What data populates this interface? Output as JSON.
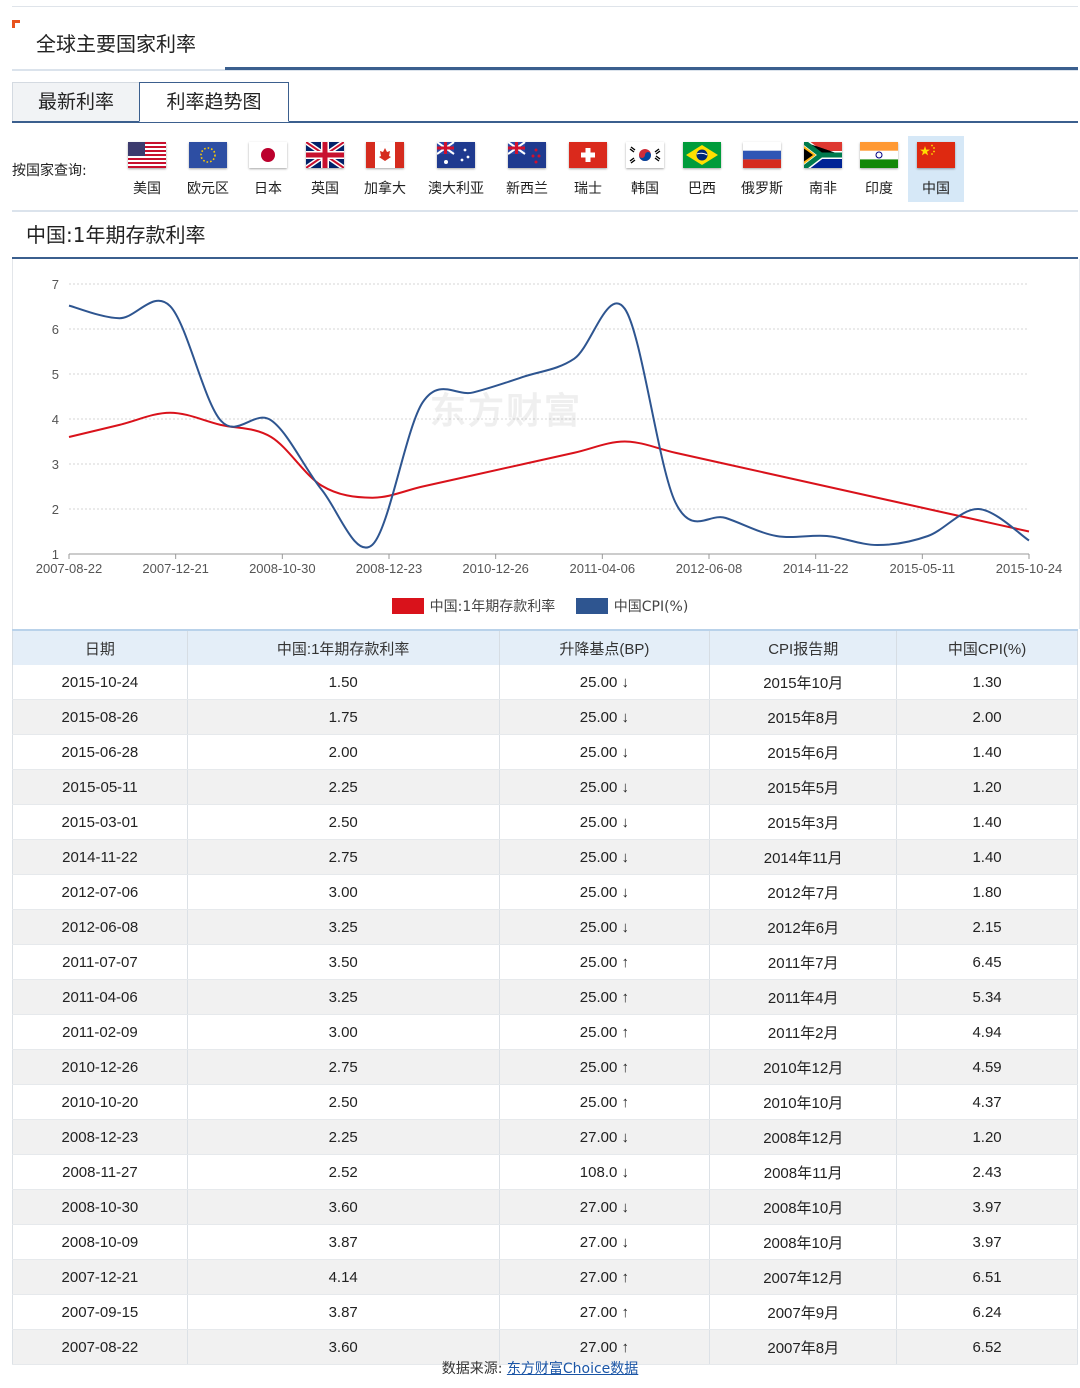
{
  "page": {
    "title": "全球主要国家利率"
  },
  "tabs": [
    {
      "label": "最新利率",
      "active": false
    },
    {
      "label": "利率趋势图",
      "active": true
    }
  ],
  "country_label": "按国家查询:",
  "countries": [
    {
      "name": "美国",
      "flag": "us-flag-icon"
    },
    {
      "name": "欧元区",
      "flag": "eu-flag-icon"
    },
    {
      "name": "日本",
      "flag": "jp-flag-icon"
    },
    {
      "name": "英国",
      "flag": "uk-flag-icon"
    },
    {
      "name": "加拿大",
      "flag": "ca-flag-icon"
    },
    {
      "name": "澳大利亚",
      "flag": "au-flag-icon"
    },
    {
      "name": "新西兰",
      "flag": "nz-flag-icon"
    },
    {
      "name": "瑞士",
      "flag": "ch-flag-icon"
    },
    {
      "name": "韩国",
      "flag": "kr-flag-icon"
    },
    {
      "name": "巴西",
      "flag": "br-flag-icon"
    },
    {
      "name": "俄罗斯",
      "flag": "ru-flag-icon"
    },
    {
      "name": "南非",
      "flag": "za-flag-icon"
    },
    {
      "name": "印度",
      "flag": "in-flag-icon"
    },
    {
      "name": "中国",
      "flag": "cn-flag-icon",
      "selected": true
    }
  ],
  "section_title": "中国:1年期存款利率",
  "watermark": "东方财富",
  "chart_data": {
    "type": "line",
    "ylim": [
      1,
      7
    ],
    "yticks": [
      "1",
      "2",
      "3",
      "4",
      "5",
      "6",
      "7"
    ],
    "xtick_labels": [
      "2007-08-22",
      "2007-12-21",
      "2008-10-30",
      "2008-12-23",
      "2010-12-26",
      "2011-04-06",
      "2012-06-08",
      "2014-11-22",
      "2015-05-11",
      "2015-10-24"
    ],
    "grid": true,
    "legend_position": "bottom",
    "series": [
      {
        "name": "中国:1年期存款利率",
        "color": "#d9121b",
        "values": [
          3.6,
          3.87,
          4.14,
          3.87,
          3.6,
          2.52,
          2.25,
          2.5,
          2.75,
          3.0,
          3.25,
          3.5,
          3.25,
          3.0,
          2.75,
          2.5,
          2.25,
          2.0,
          1.75,
          1.5
        ]
      },
      {
        "name": "中国CPI(%)",
        "color": "#2e5590",
        "values": [
          6.52,
          6.24,
          6.51,
          3.97,
          3.97,
          2.43,
          1.2,
          4.37,
          4.59,
          4.94,
          5.34,
          6.45,
          2.15,
          1.8,
          1.4,
          1.4,
          1.2,
          1.4,
          2.0,
          1.3
        ]
      }
    ]
  },
  "table": {
    "headers": [
      "日期",
      "中国:1年期存款利率",
      "升降基点(BP)",
      "CPI报告期",
      "中国CPI(%)"
    ],
    "rows": [
      {
        "date": "2015-10-24",
        "rate": "1.50",
        "bp": "25.00",
        "dir": "down",
        "period": "2015年10月",
        "cpi": "1.30"
      },
      {
        "date": "2015-08-26",
        "rate": "1.75",
        "bp": "25.00",
        "dir": "down",
        "period": "2015年8月",
        "cpi": "2.00"
      },
      {
        "date": "2015-06-28",
        "rate": "2.00",
        "bp": "25.00",
        "dir": "down",
        "period": "2015年6月",
        "cpi": "1.40"
      },
      {
        "date": "2015-05-11",
        "rate": "2.25",
        "bp": "25.00",
        "dir": "down",
        "period": "2015年5月",
        "cpi": "1.20"
      },
      {
        "date": "2015-03-01",
        "rate": "2.50",
        "bp": "25.00",
        "dir": "down",
        "period": "2015年3月",
        "cpi": "1.40"
      },
      {
        "date": "2014-11-22",
        "rate": "2.75",
        "bp": "25.00",
        "dir": "down",
        "period": "2014年11月",
        "cpi": "1.40"
      },
      {
        "date": "2012-07-06",
        "rate": "3.00",
        "bp": "25.00",
        "dir": "down",
        "period": "2012年7月",
        "cpi": "1.80"
      },
      {
        "date": "2012-06-08",
        "rate": "3.25",
        "bp": "25.00",
        "dir": "down",
        "period": "2012年6月",
        "cpi": "2.15"
      },
      {
        "date": "2011-07-07",
        "rate": "3.50",
        "bp": "25.00",
        "dir": "up",
        "period": "2011年7月",
        "cpi": "6.45"
      },
      {
        "date": "2011-04-06",
        "rate": "3.25",
        "bp": "25.00",
        "dir": "up",
        "period": "2011年4月",
        "cpi": "5.34"
      },
      {
        "date": "2011-02-09",
        "rate": "3.00",
        "bp": "25.00",
        "dir": "up",
        "period": "2011年2月",
        "cpi": "4.94"
      },
      {
        "date": "2010-12-26",
        "rate": "2.75",
        "bp": "25.00",
        "dir": "up",
        "period": "2010年12月",
        "cpi": "4.59"
      },
      {
        "date": "2010-10-20",
        "rate": "2.50",
        "bp": "25.00",
        "dir": "up",
        "period": "2010年10月",
        "cpi": "4.37"
      },
      {
        "date": "2008-12-23",
        "rate": "2.25",
        "bp": "27.00",
        "dir": "down",
        "period": "2008年12月",
        "cpi": "1.20"
      },
      {
        "date": "2008-11-27",
        "rate": "2.52",
        "bp": "108.0",
        "dir": "down",
        "period": "2008年11月",
        "cpi": "2.43"
      },
      {
        "date": "2008-10-30",
        "rate": "3.60",
        "bp": "27.00",
        "dir": "down",
        "period": "2008年10月",
        "cpi": "3.97"
      },
      {
        "date": "2008-10-09",
        "rate": "3.87",
        "bp": "27.00",
        "dir": "down",
        "period": "2008年10月",
        "cpi": "3.97"
      },
      {
        "date": "2007-12-21",
        "rate": "4.14",
        "bp": "27.00",
        "dir": "up",
        "period": "2007年12月",
        "cpi": "6.51"
      },
      {
        "date": "2007-09-15",
        "rate": "3.87",
        "bp": "27.00",
        "dir": "up",
        "period": "2007年9月",
        "cpi": "6.24"
      },
      {
        "date": "2007-08-22",
        "rate": "3.60",
        "bp": "27.00",
        "dir": "up",
        "period": "2007年8月",
        "cpi": "6.52"
      }
    ]
  },
  "footer": {
    "label": "数据来源:",
    "link": "东方财富Choice数据"
  },
  "colors": {
    "accent": "#3b5f8e",
    "up": "#e0302c",
    "down": "#1f9a25",
    "selected_bg": "#d6e8f7"
  }
}
